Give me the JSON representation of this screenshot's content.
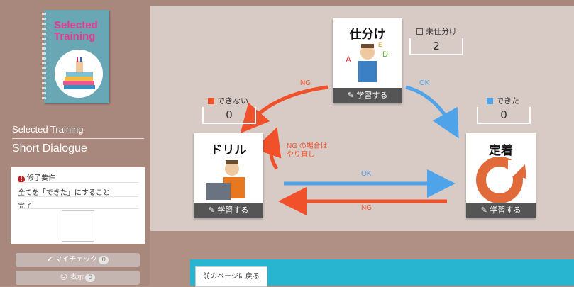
{
  "sidebar": {
    "cover_title_line1": "Selected",
    "cover_title_line2": "Training",
    "course_label": "Selected Training",
    "lesson_title": "Short Dialogue",
    "requirement": {
      "icon": "exclamation-icon",
      "header": "修了要件",
      "description": "全てを「できた」にすること",
      "status": "完了"
    },
    "mycheck_label": "マイチェック",
    "mycheck_count": "0",
    "note_label": "表示",
    "note_count": "0"
  },
  "cycle": {
    "sort": {
      "title": "仕分け",
      "button": "学習する"
    },
    "drill": {
      "title": "ドリル",
      "button": "学習する"
    },
    "fixed": {
      "title": "定着",
      "button": "学習する"
    },
    "unsorted_label": "未仕分け",
    "unsorted_count": "2",
    "cannot_label": "できない",
    "cannot_count": "0",
    "can_label": "できた",
    "can_count": "0",
    "ng_sort_label": "NG",
    "ok_sort_label": "OK",
    "retry_label_line1": "NG の場合は",
    "retry_label_line2": "やり直し",
    "ok_drill_label": "OK",
    "ng_fixed_label": "NG"
  },
  "footer": {
    "back_label": "前のページに戻る"
  },
  "colors": {
    "ng": "#f0502a",
    "ok": "#4fa3e8",
    "accent_pink": "#e8378e",
    "footer_cyan": "#27b5cf"
  }
}
